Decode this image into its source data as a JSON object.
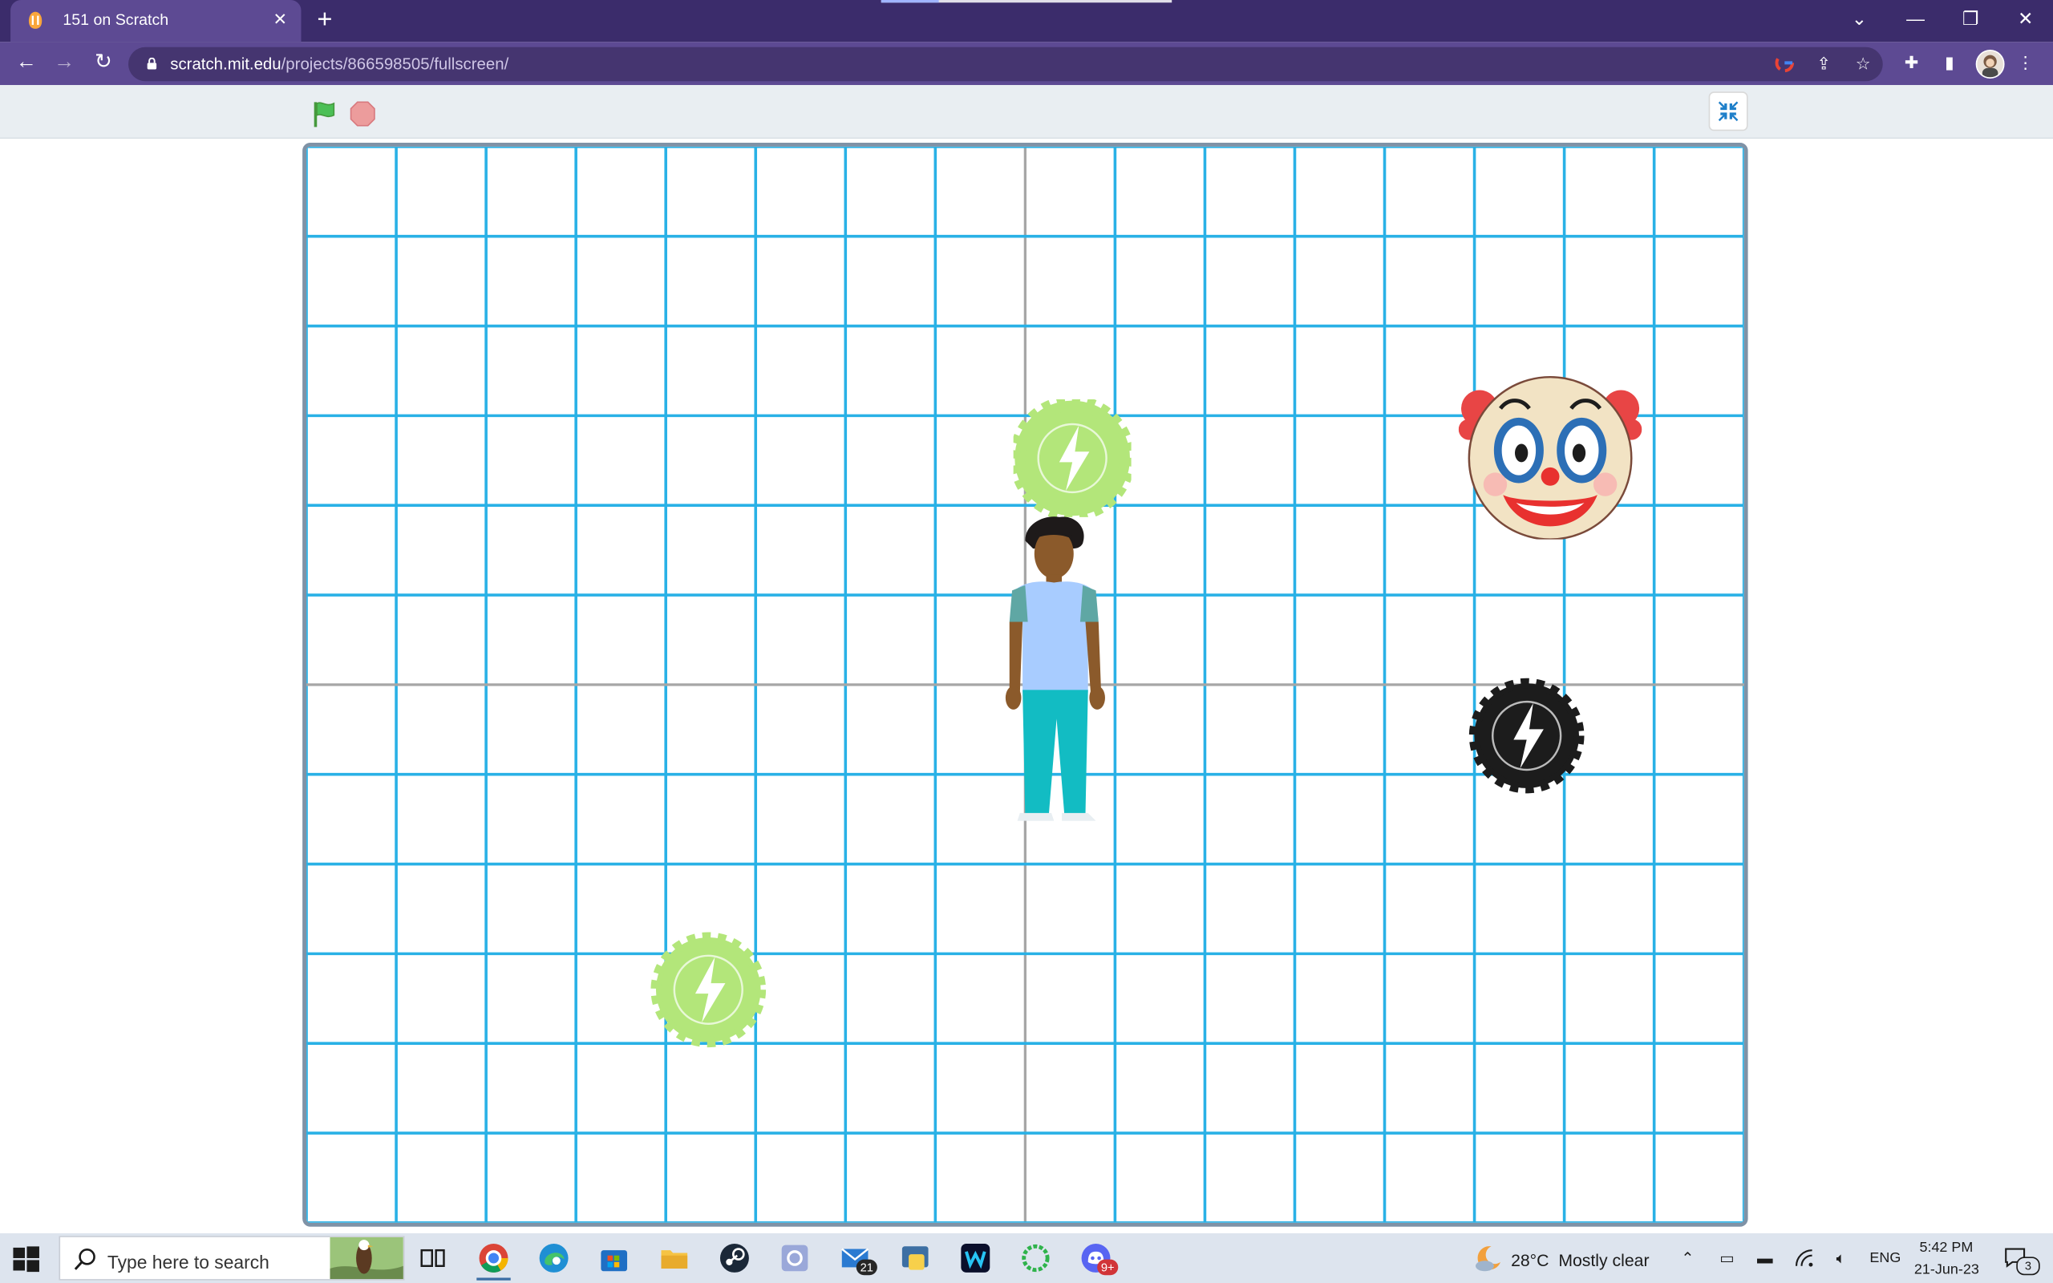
{
  "browser": {
    "tab": {
      "title": "151 on Scratch",
      "favicon": "scratch-cat-icon"
    },
    "address": {
      "domain": "scratch.mit.edu",
      "path": "/projects/866598505/fullscreen/"
    },
    "toolbar_icons": [
      "google-icon",
      "share-icon",
      "bookmark-star-icon",
      "extensions-icon",
      "side-panel-icon",
      "profile-avatar"
    ],
    "colors": {
      "frame": "#3b2c6b",
      "toolbar": "#5d4a93"
    }
  },
  "scratch": {
    "controls": [
      "green-flag-icon",
      "stop-icon",
      "exit-fullscreen-icon"
    ],
    "stage": {
      "grid_columns": 16,
      "grid_rows": 12,
      "colors": {
        "grid": "#29b1e6",
        "axis": "#a6a6a6"
      },
      "sprites": [
        "energy-gear-green-icon",
        "person-sprite",
        "clown-face-sprite",
        "energy-gear-black-icon",
        "energy-gear-green-icon"
      ]
    }
  },
  "taskbar": {
    "search_placeholder": "Type here to search",
    "apps": [
      "task-view-icon",
      "chrome-icon",
      "edge-icon",
      "store-icon",
      "file-explorer-icon",
      "steam-icon",
      "app-icon",
      "mail-icon",
      "python-icon",
      "webex-icon",
      "ring-app-icon",
      "discord-icon"
    ],
    "mail_badge": "21",
    "discord_badge": "9+",
    "weather": {
      "temperature": "28°C",
      "condition": "Mostly clear"
    },
    "language": "ENG",
    "time": "5:42 PM",
    "date": "21-Jun-23",
    "notification_count": "3"
  }
}
